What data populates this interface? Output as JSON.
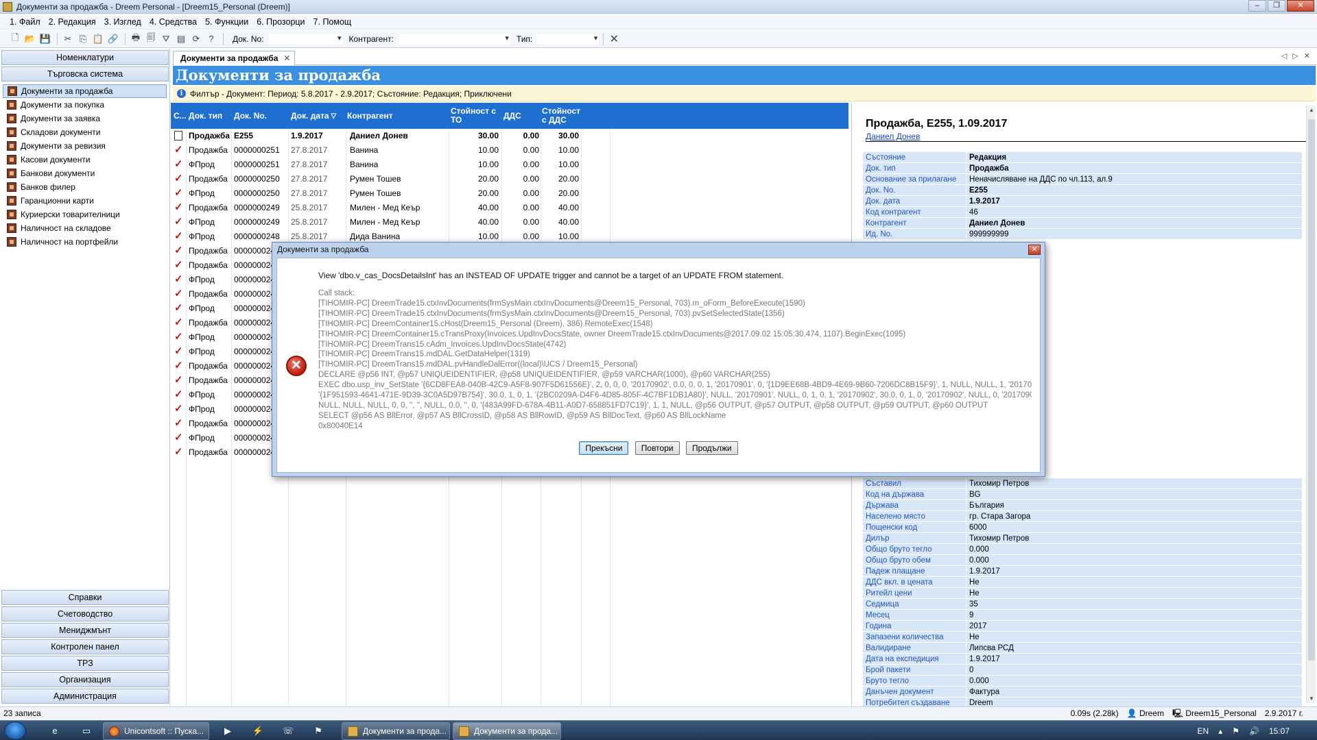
{
  "window": {
    "title": "Документи за продажба - Dreem Personal - [Dreem15_Personal (Dreem)]"
  },
  "menu": [
    "1. Файл",
    "2. Редакция",
    "3. Изглед",
    "4. Средства",
    "5. Функции",
    "6. Прозорци",
    "7. Помощ"
  ],
  "toolbar": {
    "doc_no_label": "Док. No:",
    "contragent_label": "Контрагент:",
    "type_label": "Тип:"
  },
  "nav": {
    "top_headers": [
      "Номенклатури",
      "Търговска система"
    ],
    "items": [
      "Документи за продажба",
      "Документи за покупка",
      "Документи за заявка",
      "Складови документи",
      "Документи за ревизия",
      "Касови документи",
      "Банкови документи",
      "Банков филер",
      "Гаранционни карти",
      "Куриерски товарителници",
      "Наличност на складове",
      "Наличност на портфейли"
    ],
    "bottom_headers": [
      "Справки",
      "Счетоводство",
      "Мениджмънт",
      "Контролен панел",
      "ТРЗ",
      "Организация",
      "Администрация"
    ]
  },
  "tab": {
    "label": "Документи за продажба"
  },
  "page": {
    "title": "Документи за продажба",
    "filter": "Филтър - Документ: Период: 5.8.2017 - 2.9.2017; Състояние: Редакция; Приключени"
  },
  "grid": {
    "columns": {
      "status": "С...",
      "type": "Док. тип",
      "no": "Док. No.",
      "date": "Док. дата",
      "contragent": "Контрагент",
      "value_line1": "Стойност с",
      "value_line2": "ТО",
      "vat": "ДДС",
      "total_line1": "Стойност",
      "total_line2": "с ДДС"
    },
    "rows": [
      {
        "type": "Продажба",
        "no": "E255",
        "date": "1.9.2017",
        "contragent": "Даниел Донев",
        "value": "30.00",
        "vat": "0.00",
        "total": "30.00"
      },
      {
        "type": "Продажба",
        "no": "0000000251",
        "date": "27.8.2017",
        "contragent": "Ванина",
        "value": "10.00",
        "vat": "0.00",
        "total": "10.00"
      },
      {
        "type": "ФПрод",
        "no": "0000000251",
        "date": "27.8.2017",
        "contragent": "Ванина",
        "value": "10.00",
        "vat": "0.00",
        "total": "10.00"
      },
      {
        "type": "Продажба",
        "no": "0000000250",
        "date": "27.8.2017",
        "contragent": "Румен Тошев",
        "value": "20.00",
        "vat": "0.00",
        "total": "20.00"
      },
      {
        "type": "ФПрод",
        "no": "0000000250",
        "date": "27.8.2017",
        "contragent": "Румен Тошев",
        "value": "20.00",
        "vat": "0.00",
        "total": "20.00"
      },
      {
        "type": "Продажба",
        "no": "0000000249",
        "date": "25.8.2017",
        "contragent": "Милен - Мед Кеър",
        "value": "40.00",
        "vat": "0.00",
        "total": "40.00"
      },
      {
        "type": "ФПрод",
        "no": "0000000249",
        "date": "25.8.2017",
        "contragent": "Милен - Мед Кеър",
        "value": "40.00",
        "vat": "0.00",
        "total": "40.00"
      },
      {
        "type": "ФПрод",
        "no": "0000000248",
        "date": "25.8.2017",
        "contragent": "Дида Ванина",
        "value": "10.00",
        "vat": "0.00",
        "total": "10.00"
      },
      {
        "type": "Продажба",
        "no": "000000024",
        "date": "",
        "contragent": "",
        "value": "",
        "vat": "",
        "total": ""
      },
      {
        "type": "Продажба",
        "no": "000000024",
        "date": "",
        "contragent": "",
        "value": "",
        "vat": "",
        "total": ""
      },
      {
        "type": "ФПрод",
        "no": "000000024",
        "date": "",
        "contragent": "",
        "value": "",
        "vat": "",
        "total": ""
      },
      {
        "type": "Продажба",
        "no": "000000024",
        "date": "",
        "contragent": "",
        "value": "",
        "vat": "",
        "total": ""
      },
      {
        "type": "ФПрод",
        "no": "000000024",
        "date": "",
        "contragent": "",
        "value": "",
        "vat": "",
        "total": ""
      },
      {
        "type": "Продажба",
        "no": "000000024",
        "date": "",
        "contragent": "",
        "value": "",
        "vat": "",
        "total": ""
      },
      {
        "type": "ФПрод",
        "no": "000000024",
        "date": "",
        "contragent": "",
        "value": "",
        "vat": "",
        "total": ""
      },
      {
        "type": "ФПрод",
        "no": "000000024",
        "date": "",
        "contragent": "",
        "value": "",
        "vat": "",
        "total": ""
      },
      {
        "type": "Продажба",
        "no": "000000024",
        "date": "",
        "contragent": "",
        "value": "",
        "vat": "",
        "total": ""
      },
      {
        "type": "Продажба",
        "no": "000000024",
        "date": "",
        "contragent": "",
        "value": "",
        "vat": "",
        "total": ""
      },
      {
        "type": "ФПрод",
        "no": "000000024",
        "date": "",
        "contragent": "",
        "value": "",
        "vat": "",
        "total": ""
      },
      {
        "type": "ФПрод",
        "no": "000000024",
        "date": "",
        "contragent": "",
        "value": "",
        "vat": "",
        "total": ""
      },
      {
        "type": "Продажба",
        "no": "000000024",
        "date": "",
        "contragent": "",
        "value": "",
        "vat": "",
        "total": ""
      },
      {
        "type": "ФПрод",
        "no": "000000024",
        "date": "",
        "contragent": "",
        "value": "",
        "vat": "",
        "total": ""
      },
      {
        "type": "Продажба",
        "no": "000000024",
        "date": "",
        "contragent": "",
        "value": "",
        "vat": "",
        "total": ""
      }
    ]
  },
  "detail": {
    "title": "Продажба, E255, 1.09.2017",
    "subtitle": "Даниел Донев",
    "props_top": [
      {
        "k": "Състояние",
        "v": "Редакция",
        "bold": true
      },
      {
        "k": "Док. тип",
        "v": "Продажба",
        "bold": true
      },
      {
        "k": "Основание за прилагане",
        "v": "Неначисляване на ДДС по чл.113, ал.9",
        "bold": false
      },
      {
        "k": "Док. No.",
        "v": "E255",
        "bold": true
      },
      {
        "k": "Док. дата",
        "v": "1.9.2017",
        "bold": true
      },
      {
        "k": "Код контрагент",
        "v": "46",
        "bold": false
      },
      {
        "k": "Контрагент",
        "v": "Даниел Донев",
        "bold": true
      },
      {
        "k": "Ид. No.",
        "v": "999999999",
        "bold": false
      }
    ],
    "props_bottom": [
      {
        "k": "Съставил",
        "v": "Тихомир Петров"
      },
      {
        "k": "Код на държава",
        "v": "BG"
      },
      {
        "k": "Държава",
        "v": "България"
      },
      {
        "k": "Населено място",
        "v": "гр. Стара Загора"
      },
      {
        "k": "Пощенски код",
        "v": "6000"
      },
      {
        "k": "Дилър",
        "v": "Тихомир Петров"
      },
      {
        "k": "Общо бруто тегло",
        "v": "0.000"
      },
      {
        "k": "Общо бруто обем",
        "v": "0.000"
      },
      {
        "k": "Падеж плащане",
        "v": "1.9.2017"
      },
      {
        "k": "ДДС вкл. в цената",
        "v": "Не"
      },
      {
        "k": "Ритейл цени",
        "v": "Не"
      },
      {
        "k": "Седмица",
        "v": "35"
      },
      {
        "k": "Месец",
        "v": "9"
      },
      {
        "k": "Година",
        "v": "2017"
      },
      {
        "k": "Запазени количества",
        "v": "Не"
      },
      {
        "k": "Валидиране",
        "v": "Липсва РСД"
      },
      {
        "k": "Дата на експедиция",
        "v": "1.9.2017"
      },
      {
        "k": "Брой пакети",
        "v": "0"
      },
      {
        "k": "Бруто тегло",
        "v": "0.000"
      },
      {
        "k": "Данъчен документ",
        "v": "Фактура"
      },
      {
        "k": "Потребител създаване",
        "v": "Dreem"
      }
    ]
  },
  "dialog": {
    "title": "Документи за продажба",
    "message": "View 'dbo.v_cas_DocsDetailsInt' has an INSTEAD OF UPDATE trigger and cannot be a target of an UPDATE FROM statement.",
    "stack": [
      "Call stack:",
      "[TIHOMIR-PC] DreemTrade15.ctxInvDocuments(frmSysMain.ctxInvDocuments@Dreem15_Personal, 703).m_oForm_BeforeExecute(1590)",
      "[TIHOMIR-PC] DreemTrade15.ctxInvDocuments(frmSysMain.ctxInvDocuments@Dreem15_Personal, 703).pvSetSelectedState(1356)",
      "[TIHOMIR-PC] DreemContainer15.cHost(Dreem15_Personal (Dreem), 386).RemoteExec(1548)",
      "[TIHOMIR-PC] DreemContainer15.cTransProxy(Invoices.UpdInvDocsState, owner DreemTrade15.ctxInvDocuments@2017.09.02 15:05:30.474, 1107).BeginExec(1095)",
      "[TIHOMIR-PC] DreemTrans15.cAdm_Invoices.UpdInvDocsState(4742)",
      "[TIHOMIR-PC] DreemTrans15.mdDAL.GetDataHelper(1319)",
      "[TIHOMIR-PC] DreemTrans15.mdDAL.pvHandleDalError((local)\\UCS / Dreem15_Personal)",
      "DECLARE @p56 INT, @p57 UNIQUEIDENTIFIER, @p58 UNIQUEIDENTIFIER, @p59 VARCHAR(1000), @p60 VARCHAR(255)",
      "EXEC dbo.usp_inv_SetState '{6CD8FEA8-040B-42C9-A5F8-907F5D61556E}', 2, 0, 0, 0, '20170902', 0.0, 0, 0, 1, '20170901', 0, '{1D9EE68B-4BD9-4E69-9B60-7206DC8B15F9}', 1, NULL, NULL, 1, '20170901',",
      "'{1F951593-4641-471E-9D39-3C0A5D97B754}', 30.0, 1, 0, 1, '{2BC0209A-D4F6-4D85-805F-4C7BF1DB1A80}', NULL, '20170901', NULL, 0, 1, 0, 1, '20170902', 30.0, 0, 1, 0, '20170902', NULL, 0, '20170902',",
      "NULL, NULL, NULL, 0, 0, '', '', NULL, 0.0, '', 0, '{483A99FD-678A-4B11-A0D7-658851FD7C19}', 1, 1, NULL, @p56 OUTPUT, @p57 OUTPUT, @p58 OUTPUT, @p59 OUTPUT, @p60 OUTPUT",
      "SELECT @p56 AS BllError, @p57 AS BllCrossID, @p58 AS BllRowID, @p59 AS BllDocText, @p60 AS BllLockName",
      "0x80040E14"
    ],
    "buttons": [
      "Прекъсни",
      "Повтори",
      "Продължи"
    ]
  },
  "status": {
    "records": "23 записа",
    "timing": "0.09s (2.28k)",
    "user": "Dreem",
    "db": "Dreem15_Personal",
    "date": "2.9.2017 г."
  },
  "taskbar": {
    "tasks": [
      "Unicontsoft :: Пуска...",
      "Документи за прода...",
      "Документи за прода..."
    ],
    "lang": "EN",
    "time": "15:07"
  },
  "colors": {
    "header_blue": "#3a8fe0",
    "grid_header": "#1f6fd1",
    "filter_bg": "#fbf7d6",
    "detail_key": "#2654b8"
  }
}
